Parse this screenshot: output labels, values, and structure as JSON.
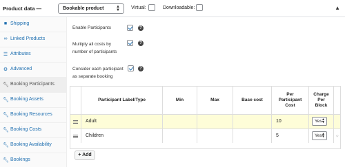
{
  "header": {
    "title": "Product data —",
    "product_type": "Bookable product",
    "virtual_label": "Virtual:",
    "downloadable_label": "Downloadable:"
  },
  "sidebar": {
    "items": [
      {
        "label": "Shipping",
        "icon": "truck-icon",
        "active": false
      },
      {
        "label": "Linked Products",
        "icon": "link-icon",
        "active": false
      },
      {
        "label": "Attributes",
        "icon": "list-icon",
        "active": false
      },
      {
        "label": "Advanced",
        "icon": "gear-icon",
        "active": false
      },
      {
        "label": "Booking Participants",
        "icon": "wrench-icon",
        "active": true
      },
      {
        "label": "Booking Assets",
        "icon": "wrench-icon",
        "active": false
      },
      {
        "label": "Booking Resources",
        "icon": "wrench-icon",
        "active": false
      },
      {
        "label": "Booking Costs",
        "icon": "wrench-icon",
        "active": false
      },
      {
        "label": "Booking Availability",
        "icon": "wrench-icon",
        "active": false
      },
      {
        "label": "Bookings",
        "icon": "wrench-icon",
        "active": false
      }
    ]
  },
  "options": {
    "enable_participants": "Enable Participants",
    "multiply_line1": "Multiply all costs by",
    "multiply_line2": "number of participants",
    "consider_line1": "Consider each participant",
    "consider_line2": "as separate booking",
    "help": "?"
  },
  "table": {
    "headers": {
      "label": "Participant Label/Type",
      "min": "Min",
      "max": "Max",
      "base_cost": "Base cost",
      "per_participant_1": "Per",
      "per_participant_2": "Participant",
      "per_participant_3": "Cost",
      "charge_1": "Charge",
      "charge_2": "Per",
      "charge_3": "Block"
    },
    "rows": [
      {
        "label": "Adult",
        "min": "",
        "max": "",
        "base_cost": "",
        "per_participant_cost": "10",
        "charge_per_block": "Yes"
      },
      {
        "label": "Children",
        "min": "",
        "max": "",
        "base_cost": "",
        "per_participant_cost": "5",
        "charge_per_block": "Yes"
      }
    ]
  },
  "add_button": "+ Add",
  "colors": {
    "link": "#2271b1",
    "highlight": "#fefdd8"
  }
}
